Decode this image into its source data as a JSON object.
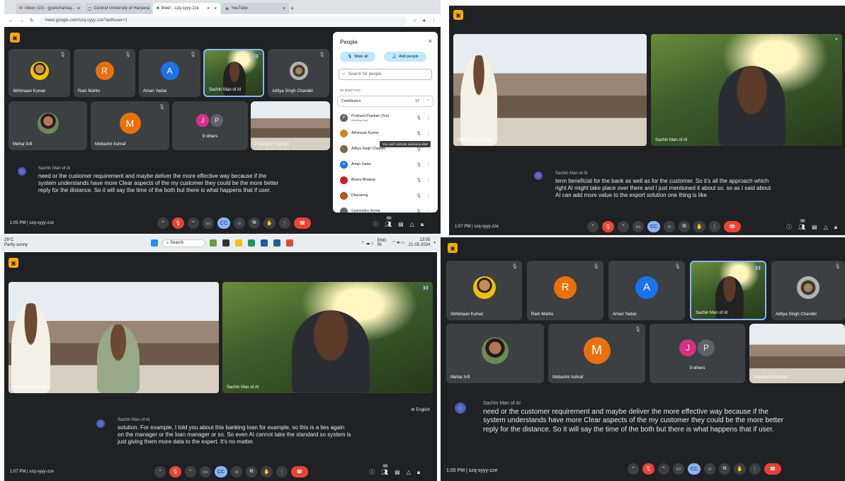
{
  "q1": {
    "tabs": [
      {
        "label": "Inbox (10) - gyanshankaj..."
      },
      {
        "label": "Central University of Haryana"
      },
      {
        "label": "Meet - szq-syyy-zze"
      },
      {
        "label": "YouTube"
      }
    ],
    "url": "meet.google.com/szq-syyy-zze?authuser=1",
    "tiles_row1": [
      {
        "name": "Abhimaan Kumar",
        "kind": "photo"
      },
      {
        "name": "Ram Mahto",
        "initial": "R",
        "color": "#e8710a"
      },
      {
        "name": "Aman Yadav",
        "initial": "A",
        "color": "#1a73e8"
      },
      {
        "name": "Sachin Man of AI",
        "kind": "video"
      },
      {
        "name": "Aditya Singh Chandel",
        "kind": "photo"
      }
    ],
    "tiles_row2": [
      {
        "name": "Mehar Arfi",
        "kind": "photo"
      },
      {
        "name": "Mobashir Ashraf",
        "initial": "M",
        "color": "#e8710a"
      },
      {
        "name": "9 others",
        "initials": [
          "J",
          "P"
        ]
      },
      {
        "name": "Prashant Prashan",
        "kind": "video"
      }
    ],
    "caption": {
      "speaker": "Sachin Man of AI",
      "text": "need or the customer requirement and maybe deliver the more effective way because if the system understands have more Clear aspects of the my customer they could be the more better reply for the distance. So it will say the time of the both but there is what happens that if user."
    },
    "time": "1:05 PM",
    "code": "szq-syyy-zze",
    "people_badge": "17",
    "panel": {
      "title": "People",
      "mute_all": "Mute all",
      "add_people": "Add people",
      "search_placeholder": "Search for people",
      "in_meeting": "IN MEETING",
      "contributors": "Contributors",
      "contributors_count": "17",
      "tooltip": "You can't unmute someone else",
      "people": [
        {
          "name": "Prashant Prashan (You)",
          "sub": "Meeting host",
          "initial": "P",
          "color": "#5f6368"
        },
        {
          "name": "Abhimaan Kumar",
          "initial": "",
          "color": "#c58a2a"
        },
        {
          "name": "Aditya Singh Chandel",
          "initial": "",
          "color": "#7a6a4a"
        },
        {
          "name": "Aman Yadav",
          "initial": "A",
          "color": "#1a73e8"
        },
        {
          "name": "Bhanu Bhaskar",
          "initial": "",
          "color": "#c5221f"
        },
        {
          "name": "Dharamraj",
          "initial": "",
          "color": "#b05a2a"
        },
        {
          "name": "Gyanendra Verma",
          "initial": "",
          "color": "#666"
        }
      ]
    }
  },
  "taskbar": {
    "weather_temp": "29°C",
    "weather_desc": "Partly sunny",
    "search": "Search",
    "lang": "ENG IN",
    "time": "13:05",
    "date": "21-05-2024"
  },
  "q2": {
    "left_name": "Prashant Prashan",
    "right_name": "Sachin Man of AI",
    "caption": {
      "speaker": "Sachin Man of AI",
      "text": "term beneficial for the bank as well as for the customer. So it's all the approach which right AI might take place over there and I just mentioned it about so. so as I said about AI can add more value to the export solution one thing is like"
    },
    "time": "1:07 PM",
    "code": "szq-syyy-zze",
    "people_badge": "17"
  },
  "q3": {
    "left_name": "Prashant Prashan",
    "right_name": "Sachin Man of AI",
    "language": "English",
    "caption": {
      "speaker": "Sachin Man of AI",
      "text": "solution. For example, I told you about this banking loan for example, so this is a lies again on the manager or the loan manager or so. So even AI cannot take the standard so system is just giving them more data to the expert. It's no matter."
    },
    "time": "1:07 PM",
    "code": "szq-syyy-zze",
    "people_badge": "17"
  },
  "q4": {
    "tiles_row1": [
      {
        "name": "Abhimaan Kumar",
        "kind": "photo"
      },
      {
        "name": "Ram Mahto",
        "initial": "R",
        "color": "#e8710a"
      },
      {
        "name": "Aman Yadav",
        "initial": "A",
        "color": "#1a73e8"
      },
      {
        "name": "Sachin Man of AI",
        "kind": "video"
      },
      {
        "name": "Aditya Singh Chandel",
        "kind": "photo"
      }
    ],
    "tiles_row2": [
      {
        "name": "Mehar Arfi",
        "kind": "photo"
      },
      {
        "name": "Mobashir Ashraf",
        "initial": "M",
        "color": "#e8710a"
      },
      {
        "name": "9 others",
        "initials": [
          "J",
          "P"
        ]
      },
      {
        "name": "Prashant Prashan",
        "kind": "video"
      }
    ],
    "caption": {
      "speaker": "Sachin Man of AI",
      "text": "need or the customer requirement and maybe deliver the more effective way because if the system understands have more Clear aspects of the my customer they could be the more better reply for the distance. So it will say the time of the both but there is what happens that if user."
    },
    "time": "1:05 PM",
    "code": "szq-syyy-zze",
    "people_badge": "17"
  },
  "colors": {
    "meet_bg": "#202124",
    "tile_bg": "#3c4043",
    "end_call": "#ea4335",
    "active_blue": "#8ab4f8",
    "logo": "#f9ab00"
  }
}
